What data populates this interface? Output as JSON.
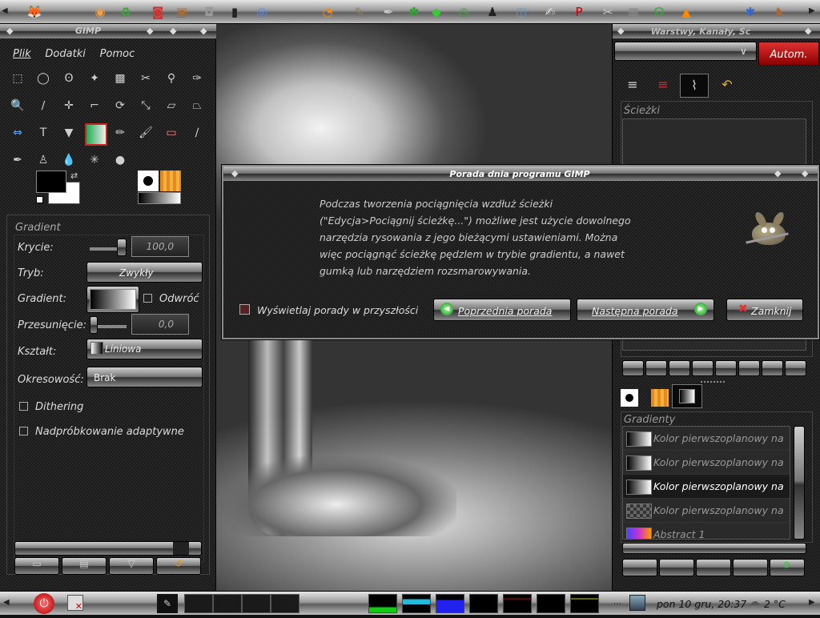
{
  "toolbox": {
    "title": "GIMP",
    "menu": [
      "Plik",
      "Dodatki",
      "Pomoc"
    ],
    "options_title": "Gradient",
    "opacity_label": "Krycie:",
    "opacity_value": "100,0",
    "mode_label": "Tryb:",
    "mode_value": "Zwykły",
    "gradient_label": "Gradient:",
    "reverse_label": "Odwróć",
    "offset_label": "Przesunięcie:",
    "offset_value": "0,0",
    "shape_label": "Kształt:",
    "shape_value": "Liniowa",
    "repeat_label": "Okresowość:",
    "repeat_value": "Brak",
    "dithering_label": "Dithering",
    "supersampling_label": "Nadpróbkowanie adaptywne"
  },
  "layers_panel": {
    "title": "Warstwy, Kanały, Śc",
    "auto_button": "Autom.",
    "paths_label": "Ścieżki",
    "gradients_label": "Gradienty",
    "gradients": [
      {
        "name": "Kolor pierwszoplanowy na",
        "selected": false
      },
      {
        "name": "Kolor pierwszoplanowy na",
        "selected": false
      },
      {
        "name": "Kolor pierwszoplanowy na",
        "selected": true
      },
      {
        "name": "Kolor pierwszoplanowy na",
        "selected": false
      },
      {
        "name": "Abstract 1",
        "selected": false
      }
    ]
  },
  "dialog": {
    "title": "Porada dnia programu GIMP",
    "tip_lines": [
      "Podczas tworzenia pociągnięcia wzdłuż ścieżki",
      "(\"Edycja>Pociągnij ścieżkę...\") możliwe jest użycie dowolnego",
      "narzędzia rysowania z jego bieżącymi ustawieniami. Można",
      "więc pociągnąć ścieżkę pędzlem w trybie gradientu, a nawet",
      "gumką lub narzędziem rozsmarowywania."
    ],
    "show_tips_label": "Wyświetlaj porady w przyszłości",
    "prev_button": "Poprzednia porada",
    "next_button": "Następna porada",
    "close_button": "Zamknij"
  },
  "taskbar": {
    "clock": "pon 10 gru, 20:37",
    "temperature": "2 °C"
  },
  "top_panel": {
    "launchers": [
      "firefox-icon",
      "cd-icon",
      "recycle-icon",
      "debian-icon",
      "box-icon",
      "camera-icon",
      "terminal-icon",
      "disk-icon",
      "blender-icon",
      "gimp-icon",
      "inkscape-icon",
      "cannabis-icon",
      "cube-icon",
      "clock-icon",
      "tux-icon",
      "finder-icon",
      "text-editor-icon",
      "pdf-icon",
      "tools-icon",
      "calculator-icon",
      "network-icon",
      "vlc-icon",
      "kde-icon",
      "deer-icon"
    ]
  },
  "colors": {
    "accent_red": "#b01818",
    "text": "#dddddd",
    "dialog_border": "#8a8a8a"
  }
}
